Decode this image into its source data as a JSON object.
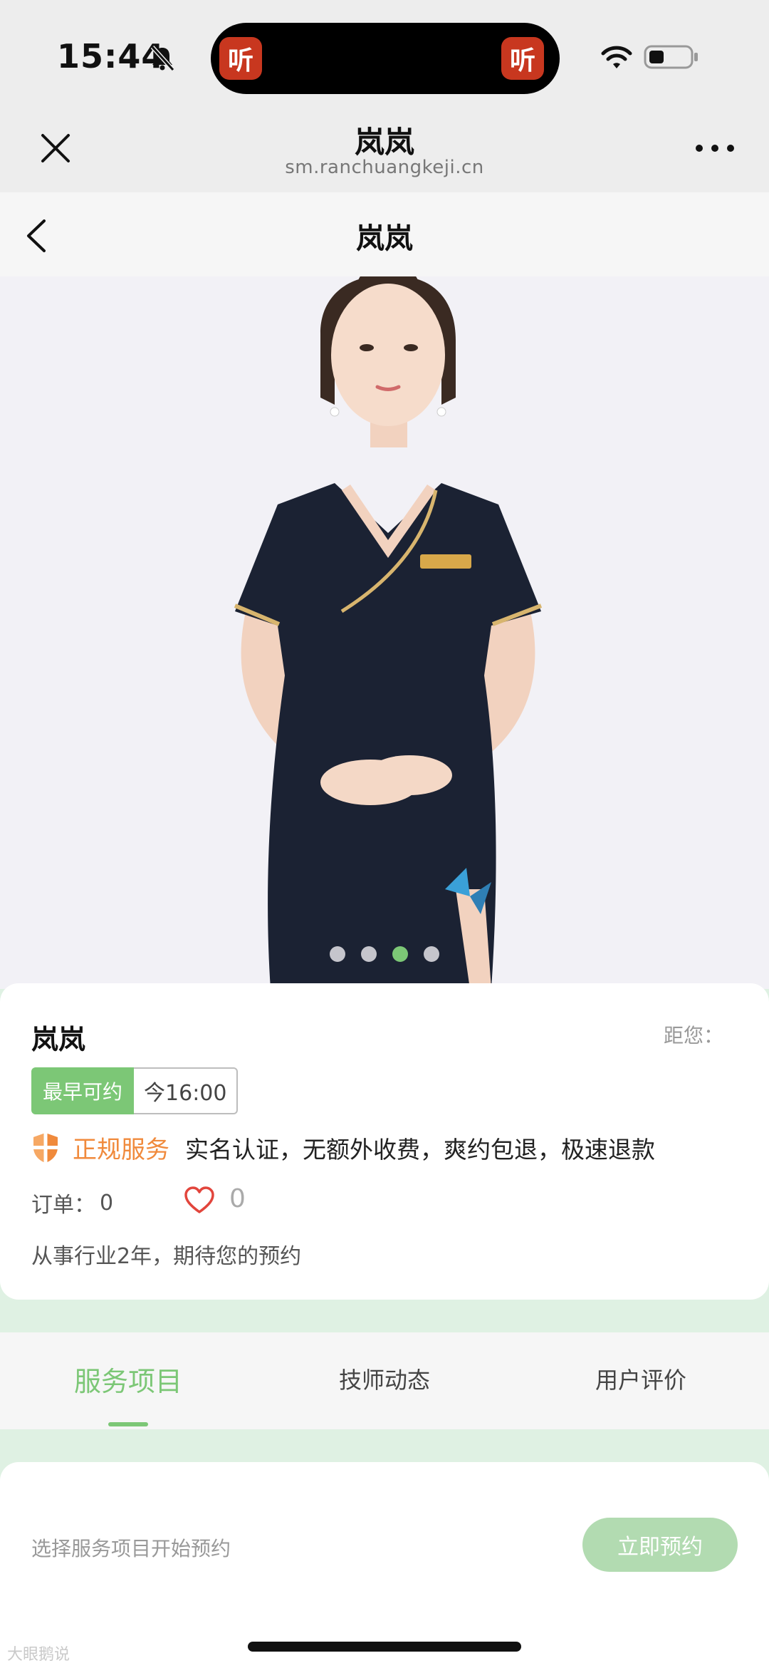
{
  "status_bar": {
    "time": "15:44",
    "island_app_glyph": "听",
    "icons": [
      "bell-slash-icon",
      "wifi-icon",
      "battery-icon"
    ]
  },
  "browser": {
    "title": "岚岚",
    "url": "sm.ranchuangkeji.cn",
    "close_icon": "close-icon",
    "more_icon": "more-dots-icon"
  },
  "nav": {
    "title": "岚岚",
    "back_icon": "chevron-left-icon"
  },
  "carousel": {
    "slide_count": 4,
    "active_index": 2
  },
  "profile": {
    "name": "岚岚",
    "distance_label": "距您：",
    "earliest_label": "最早可约",
    "earliest_value": "今16:00",
    "guarantee_tag": "正规服务",
    "guarantee_desc": "实名认证，无额外收费，爽约包退，极速退款",
    "orders_label": "订单：",
    "orders_value": "0",
    "likes_value": "0",
    "bio": "从事行业2年，期待您的预约"
  },
  "tabs": {
    "items": [
      "服务项目",
      "技师动态",
      "用户评价"
    ],
    "active_index": 0
  },
  "booking": {
    "hint": "选择服务项目开始预约",
    "button_label": "立即预约"
  },
  "watermark": "大眼鹅说",
  "colors": {
    "accent_green": "#7cc776",
    "accent_orange": "#f08a3c",
    "island_app_red": "#c8371f"
  }
}
